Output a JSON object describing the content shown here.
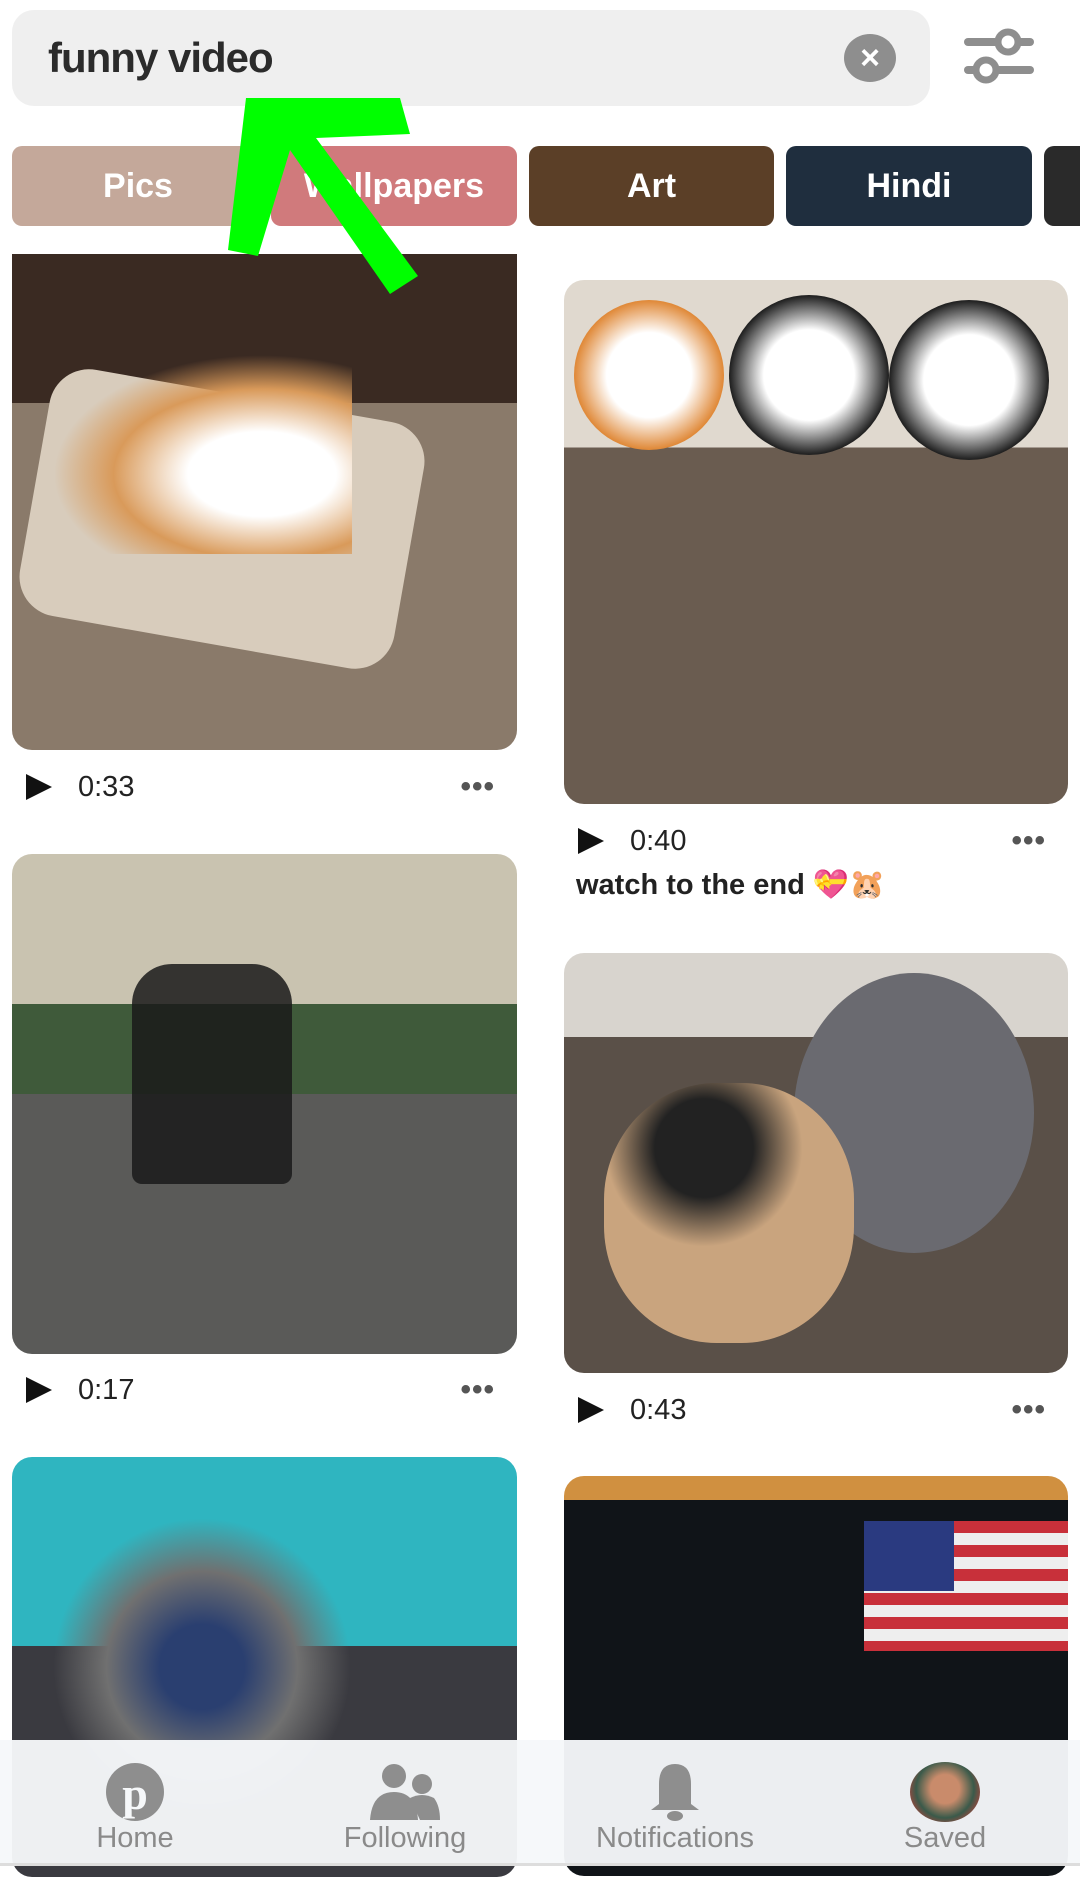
{
  "search": {
    "query": "funny video",
    "clear_icon": "close-circle-icon",
    "filter_icon": "sliders-icon"
  },
  "chips": [
    {
      "label": "Pics",
      "color": "#c4a89a"
    },
    {
      "label": "Wallpapers",
      "color": "#d07a7c"
    },
    {
      "label": "Art",
      "color": "#5b3f27"
    },
    {
      "label": "Hindi",
      "color": "#1f2e3e"
    },
    {
      "label": "",
      "color": "#2a2a2a"
    }
  ],
  "pins": [
    {
      "duration": "0:33",
      "title": ""
    },
    {
      "duration": "0:40",
      "title": "watch to the end 💝🐹"
    },
    {
      "duration": "0:17",
      "title": ""
    },
    {
      "duration": "0:43",
      "title": ""
    }
  ],
  "more_label": "•••",
  "nav": [
    {
      "label": "Home",
      "icon": "pinterest-logo-icon"
    },
    {
      "label": "Following",
      "icon": "people-icon"
    },
    {
      "label": "Notifications",
      "icon": "bell-icon"
    },
    {
      "label": "Saved",
      "icon": "avatar"
    }
  ],
  "annotation": {
    "arrow_color": "#00ff00"
  }
}
